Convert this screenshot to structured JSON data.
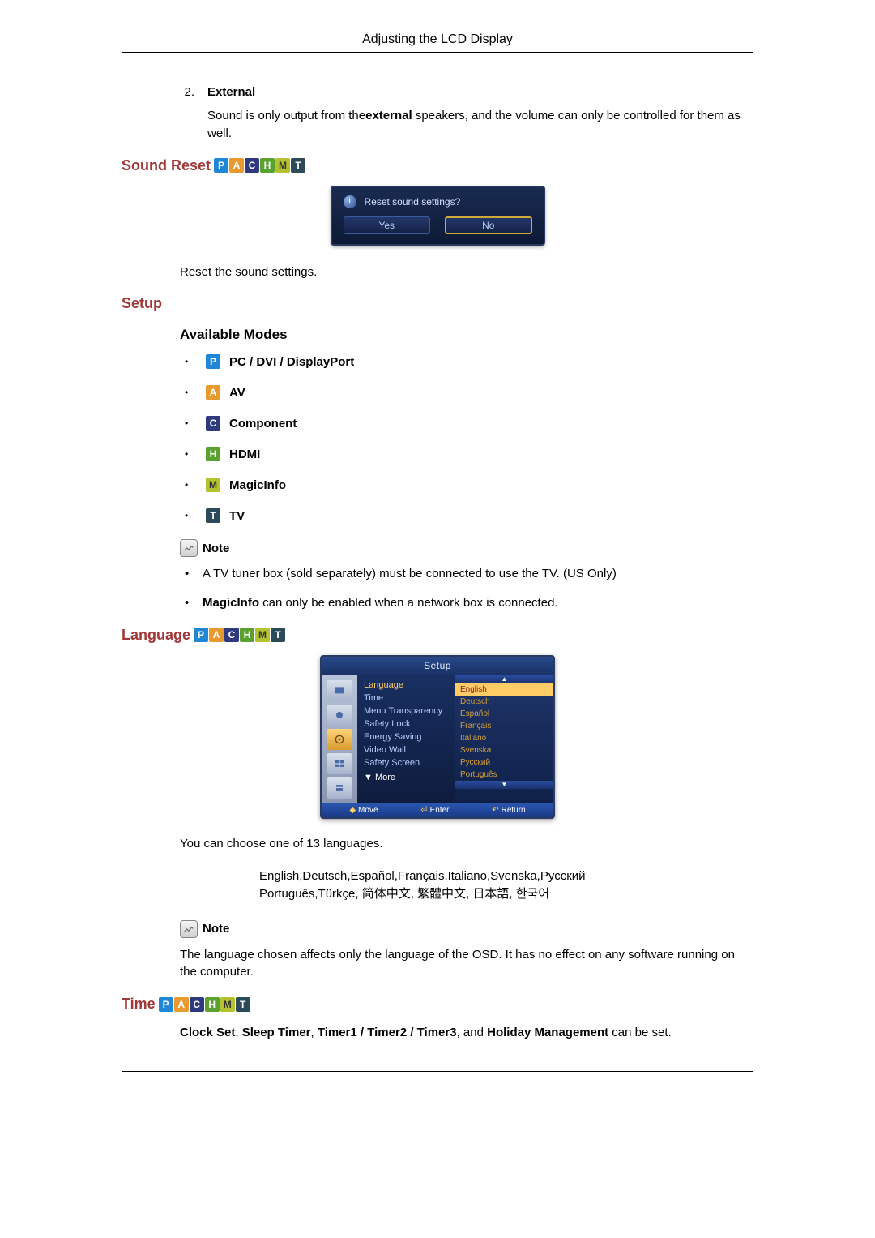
{
  "header": {
    "title": "Adjusting the LCD Display"
  },
  "external": {
    "num": "2.",
    "label": "External",
    "text_pre": "Sound is only output from the",
    "text_bold": "external",
    "text_post": " speakers, and the volume can only be controlled for them as well."
  },
  "sound_reset": {
    "heading": "Sound Reset",
    "dialog": {
      "question": "Reset sound settings?",
      "yes": "Yes",
      "no": "No"
    },
    "desc": "Reset the sound settings."
  },
  "setup_heading": "Setup",
  "available_modes": {
    "heading": "Available Modes",
    "items": [
      {
        "badge": "P",
        "label": "PC / DVI / DisplayPort"
      },
      {
        "badge": "A",
        "label": "AV"
      },
      {
        "badge": "C",
        "label": "Component"
      },
      {
        "badge": "H",
        "label": "HDMI"
      },
      {
        "badge": "M",
        "label": "MagicInfo"
      },
      {
        "badge": "T",
        "label": "TV"
      }
    ]
  },
  "note1": {
    "label": "Note",
    "b1": "A TV tuner box (sold separately) must be connected to use the TV. (US Only)",
    "b2_bold": "MagicInfo",
    "b2_rest": " can only be enabled when a network box is connected."
  },
  "language": {
    "heading": "Language",
    "osd": {
      "title": "Setup",
      "left": [
        "Language",
        "Time",
        "Menu Transparency",
        "Safety Lock",
        "Energy Saving",
        "Video Wall",
        "Safety Screen"
      ],
      "more": "▼ More",
      "right": [
        "English",
        "Deutsch",
        "Español",
        "Français",
        "Italiano",
        "Svenska",
        "Русский",
        "Português"
      ],
      "footer": {
        "move": "Move",
        "enter": "Enter",
        "return": "Return"
      }
    },
    "desc": "You can choose one of 13 languages.",
    "list_line1": "English,Deutsch,Español,Français,Italiano,Svenska,Русский",
    "list_line2": "Português,Türkçe, 简体中文,  繁體中文, 日本語, 한국어"
  },
  "note2": {
    "label": "Note",
    "text": "The language chosen affects only the language of the OSD. It has no effect on any software running on the computer."
  },
  "time": {
    "heading": "Time",
    "line_parts": {
      "p1": "Clock Set",
      "sep1": ", ",
      "p2": "Sleep Timer",
      "sep2": ", ",
      "p3": "Timer1 / Timer2 / Timer3",
      "sep3": ", and ",
      "p4": "Holiday Management",
      "tail": " can be set."
    }
  },
  "icons": {
    "P": "P",
    "A": "A",
    "C": "C",
    "H": "H",
    "M": "M",
    "T": "T"
  }
}
